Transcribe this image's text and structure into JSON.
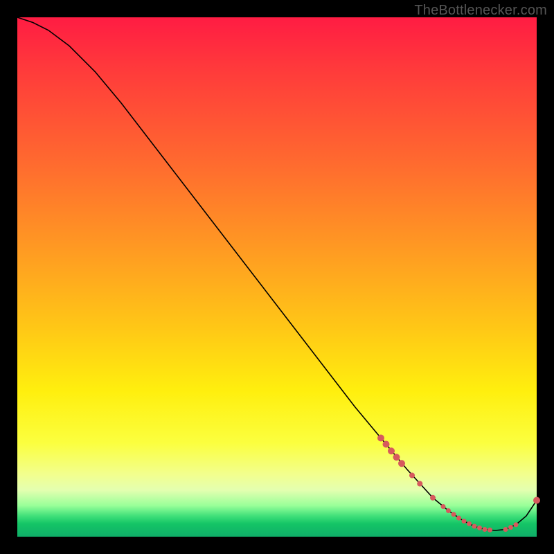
{
  "watermark": "TheBottlenecker.com",
  "colors": {
    "curve": "#000000",
    "marker": "#d65a5d",
    "background_top": "#ff1c43",
    "background_bottom": "#0fae68"
  },
  "chart_data": {
    "type": "line",
    "title": "",
    "xlabel": "",
    "ylabel": "",
    "xlim": [
      0,
      100
    ],
    "ylim": [
      0,
      100
    ],
    "grid": false,
    "legend": false,
    "series": [
      {
        "name": "bottleneck-curve",
        "x": [
          0,
          3,
          6,
          10,
          15,
          20,
          25,
          30,
          35,
          40,
          45,
          50,
          55,
          60,
          65,
          70,
          75,
          80,
          83,
          86,
          88,
          90,
          92,
          94,
          96,
          98,
          100
        ],
        "y": [
          100,
          99,
          97.5,
          94.5,
          89.5,
          83.5,
          77,
          70.5,
          64,
          57.5,
          51,
          44.5,
          38,
          31.5,
          25,
          19,
          13,
          7.5,
          5,
          3,
          2,
          1.4,
          1.2,
          1.4,
          2.3,
          4,
          7
        ]
      }
    ],
    "markers": [
      {
        "x": 70.0,
        "y": 19.0,
        "r": 5
      },
      {
        "x": 71.0,
        "y": 17.8,
        "r": 5
      },
      {
        "x": 72.0,
        "y": 16.5,
        "r": 5
      },
      {
        "x": 73.0,
        "y": 15.3,
        "r": 5
      },
      {
        "x": 74.0,
        "y": 14.1,
        "r": 5
      },
      {
        "x": 76.0,
        "y": 11.8,
        "r": 4
      },
      {
        "x": 77.5,
        "y": 10.2,
        "r": 4
      },
      {
        "x": 80.0,
        "y": 7.5,
        "r": 4
      },
      {
        "x": 82.0,
        "y": 5.8,
        "r": 3.5
      },
      {
        "x": 83.0,
        "y": 5.0,
        "r": 3.5
      },
      {
        "x": 84.0,
        "y": 4.3,
        "r": 3.5
      },
      {
        "x": 85.0,
        "y": 3.6,
        "r": 3.5
      },
      {
        "x": 86.0,
        "y": 3.0,
        "r": 3.5
      },
      {
        "x": 87.0,
        "y": 2.5,
        "r": 3.5
      },
      {
        "x": 88.0,
        "y": 2.0,
        "r": 3.5
      },
      {
        "x": 89.0,
        "y": 1.7,
        "r": 3.5
      },
      {
        "x": 90.0,
        "y": 1.4,
        "r": 3.5
      },
      {
        "x": 91.0,
        "y": 1.3,
        "r": 3.5
      },
      {
        "x": 94.0,
        "y": 1.4,
        "r": 3.5
      },
      {
        "x": 95.0,
        "y": 1.8,
        "r": 3.5
      },
      {
        "x": 96.0,
        "y": 2.3,
        "r": 3.5
      },
      {
        "x": 100.0,
        "y": 7.0,
        "r": 5
      }
    ]
  }
}
